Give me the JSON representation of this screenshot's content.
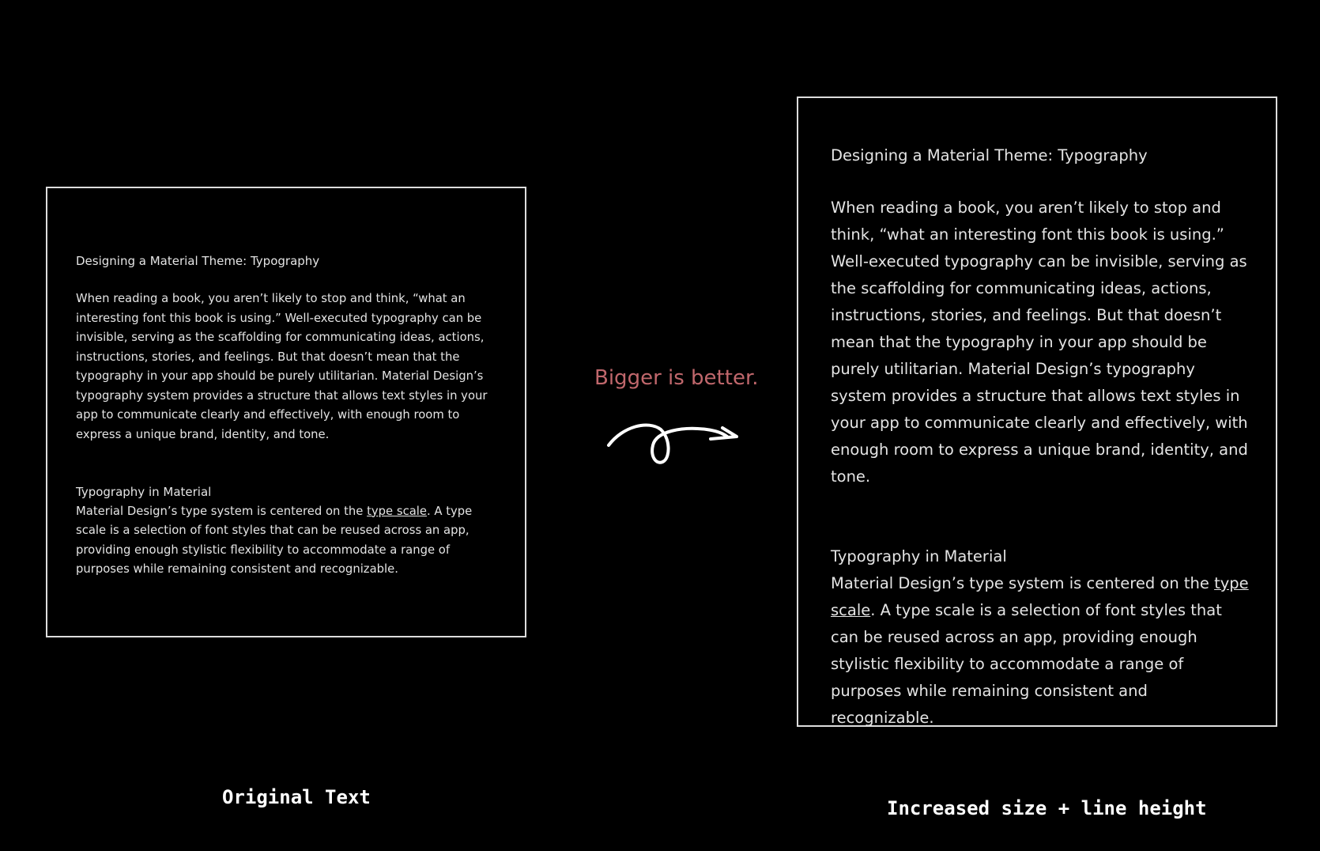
{
  "original": {
    "title": "Designing a Material Theme: Typography",
    "paragraph": "When reading a book, you aren’t likely to stop and think, “what an interesting font this book is using.” Well-executed typography can be invisible, serving as the scaffolding for communicating ideas, actions, instructions, stories, and feelings. But that doesn’t mean that the typography in your app should be purely utilitarian. Material Design’s typography system provides a structure that allows text styles in your app to communicate clearly and effectively, with enough room to express a unique brand, identity, and tone.",
    "subtitle": "Typography in Material",
    "section_text_before": "Material Design’s type system is centered on the ",
    "section_link": "type scale",
    "section_text_after": ". A type scale is a selection of font styles that can be reused across an app, providing enough stylistic flexibility to accommodate a range of purposes while remaining consistent and recognizable.",
    "caption": "Original Text"
  },
  "improved": {
    "title": "Designing a Material Theme: Typography",
    "paragraph": "When reading a book, you aren’t likely to stop and think, “what an interesting font this book is using.” Well-executed typography can be invisible, serving as the scaffolding for communicating ideas, actions, instructions, stories, and feelings. But that doesn’t mean that the typography in your app should be purely utilitarian. Material Design’s typography system provides a structure that allows text styles in your app to communicate clearly and effectively, with enough room to express a unique brand, identity, and tone.",
    "subtitle": "Typography in Material",
    "section_text_before": "Material Design’s type system is centered on the ",
    "section_link": "type scale",
    "section_text_after": ". A type scale is a selection of font styles that can be reused across an app, providing enough stylistic flexibility to accommodate a range of purposes while remaining consistent and recognizable.",
    "caption": "Increased size + line height"
  },
  "tagline": "Bigger is better.",
  "colors": {
    "background": "#000000",
    "text": "#e4e4e4",
    "border": "#dddddd",
    "tagline": "#c0676c",
    "caption": "#ffffff"
  },
  "icons": {
    "arrow": "curly-arrow-icon"
  }
}
